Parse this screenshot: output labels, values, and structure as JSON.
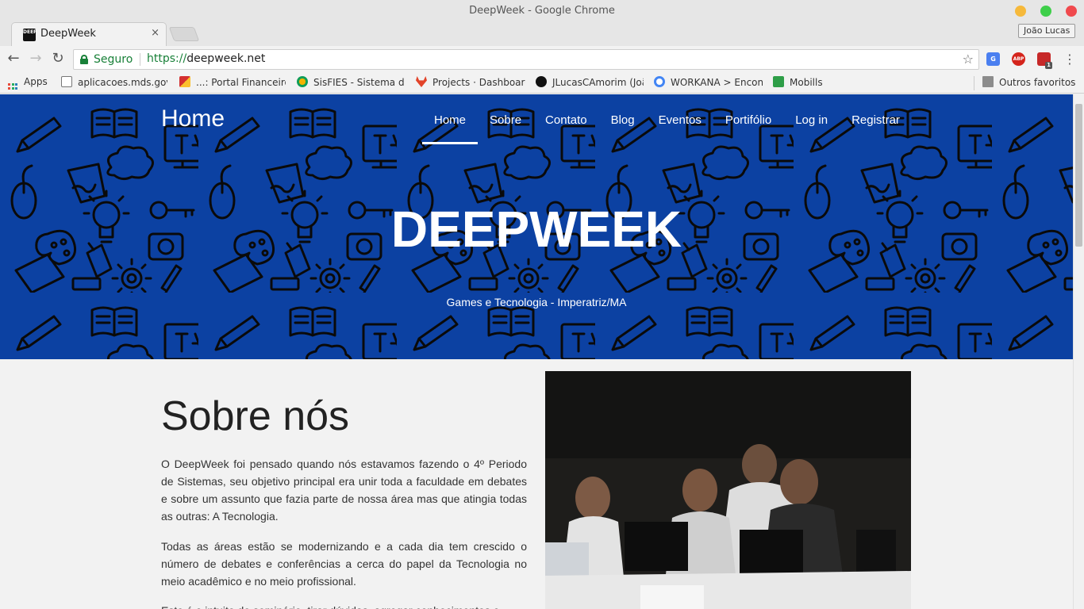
{
  "window": {
    "title": "DeepWeek - Google Chrome",
    "user": "João Lucas"
  },
  "tab": {
    "favicon_text": "DEEP",
    "title": "DeepWeek",
    "close": "×"
  },
  "toolbar": {
    "secure_label": "Seguro",
    "url_scheme": "https://",
    "url_rest": "deepweek.net",
    "ext_abp": "ABP",
    "ext_red_badge": "1"
  },
  "bookmarks": [
    {
      "label": "Apps"
    },
    {
      "label": "aplicacoes.mds.gov"
    },
    {
      "label": "...: Portal Financeiro"
    },
    {
      "label": "SisFIES - Sistema de"
    },
    {
      "label": "Projects · Dashboard"
    },
    {
      "label": "JLucasCAmorim (João"
    },
    {
      "label": "WORKANA > Encontr"
    },
    {
      "label": "Mobills"
    },
    {
      "label": "Outros favoritos"
    }
  ],
  "site": {
    "brand": "Home",
    "nav": [
      {
        "label": "Home"
      },
      {
        "label": "Sobre"
      },
      {
        "label": "Contato"
      },
      {
        "label": "Blog"
      },
      {
        "label": "Eventos"
      },
      {
        "label": "Portifólio"
      },
      {
        "label": "Log in"
      },
      {
        "label": "Registrar"
      }
    ],
    "hero_title": "DEEPWEEK",
    "hero_subtitle": "Games e Tecnologia - Imperatriz/MA",
    "hero_color": "#0c41a2"
  },
  "about": {
    "heading": "Sobre nós",
    "paragraphs": [
      "O DeepWeek foi pensado quando nós estavamos fazendo o 4º Periodo de Sistemas, seu objetivo principal era unir toda a faculdade em debates e sobre um assunto que fazia parte de nossa área mas que atingia todas as outras: A Tecnologia.",
      "Todas as áreas estão se modernizando e a cada dia tem crescido o número de debates e conferências a cerca do papel da Tecnologia no meio acadêmico e no meio profissional.",
      "Este é o intuito do seminário, tirar dúvidas, agregar conhecimentos e"
    ],
    "photo_alt": "Students working on laptops at the event"
  }
}
